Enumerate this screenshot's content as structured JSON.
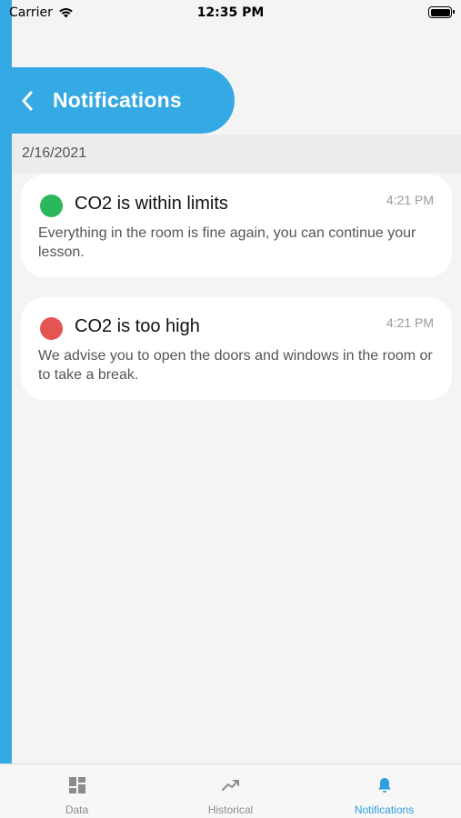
{
  "status_bar": {
    "carrier": "Carrier",
    "time": "12:35 PM",
    "icons": [
      "wifi-icon",
      "battery-icon"
    ]
  },
  "header": {
    "title": "Notifications",
    "back_icon": "chevron-left-icon",
    "background_color": "#35a9e3"
  },
  "date_section": {
    "label": "2/16/2021"
  },
  "notifications": [
    {
      "title": "CO2 is within limits",
      "time": "4:21 PM",
      "body": "Everything in the room is fine again, you can continue your lesson.",
      "status_color": "#2bb85c"
    },
    {
      "title": "CO2 is too high",
      "time": "4:21 PM",
      "body": "We advise you to open the doors and windows in the room or to take a break.",
      "status_color": "#e55353"
    }
  ],
  "tabs": [
    {
      "label": "Data",
      "icon": "dashboard-icon",
      "active": false
    },
    {
      "label": "Historical",
      "icon": "trend-icon",
      "active": false
    },
    {
      "label": "Notifications",
      "icon": "bell-icon",
      "active": true
    }
  ],
  "colors": {
    "accent": "#35a9e3",
    "active_tab": "#2f9fe0",
    "inactive_tab": "#8c8c8c"
  }
}
